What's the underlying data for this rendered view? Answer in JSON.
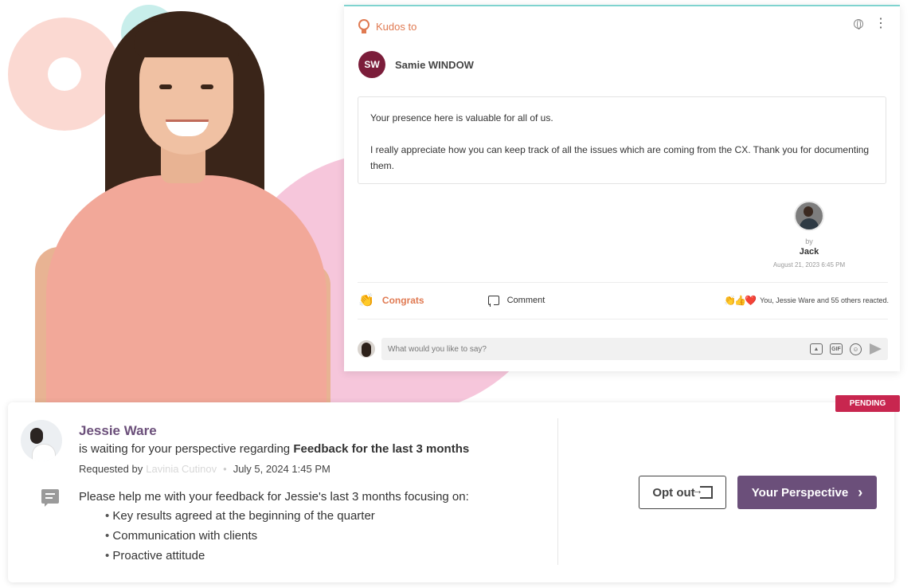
{
  "kudos": {
    "header_label": "Kudos to",
    "recipient": {
      "initials": "SW",
      "name": "Samie WINDOW"
    },
    "message": [
      "Your presence here is valuable for all of us.",
      "I really appreciate how you can keep track of all the issues which are coming from the CX. Thank you for documenting them."
    ],
    "by_label": "by",
    "sender_name": "Jack",
    "sender_date": "August 21, 2023 6:45 PM",
    "congrats_label": "Congrats",
    "comment_label": "Comment",
    "reactions_text": "You, Jessie Ware and 55 others reacted.",
    "reaction_icons": "👏👍❤️",
    "composer_placeholder": "What would you like to say?",
    "gif_label": "GIF"
  },
  "feedback": {
    "status": "PENDING",
    "name": "Jessie Ware",
    "waiting_text": "is waiting for your perspective regarding",
    "topic": "Feedback for the last 3 months",
    "requested_by_label": "Requested by",
    "requester": "Lavinia Cutinov",
    "date": "July 5, 2024 1:45 PM",
    "prompt": "Please help me with your feedback for Jessie's last 3 months focusing on:",
    "items": [
      "Key results agreed at the beginning of the quarter",
      "Communication with clients",
      "Proactive attitude"
    ],
    "opt_out_label": "Opt out",
    "perspective_label": "Your Perspective"
  },
  "colors": {
    "accent_purple": "#6b4f7a",
    "kudos_orange": "#e07a52",
    "pending_red": "#c8264f",
    "avatar_maroon": "#7b1d3a"
  }
}
